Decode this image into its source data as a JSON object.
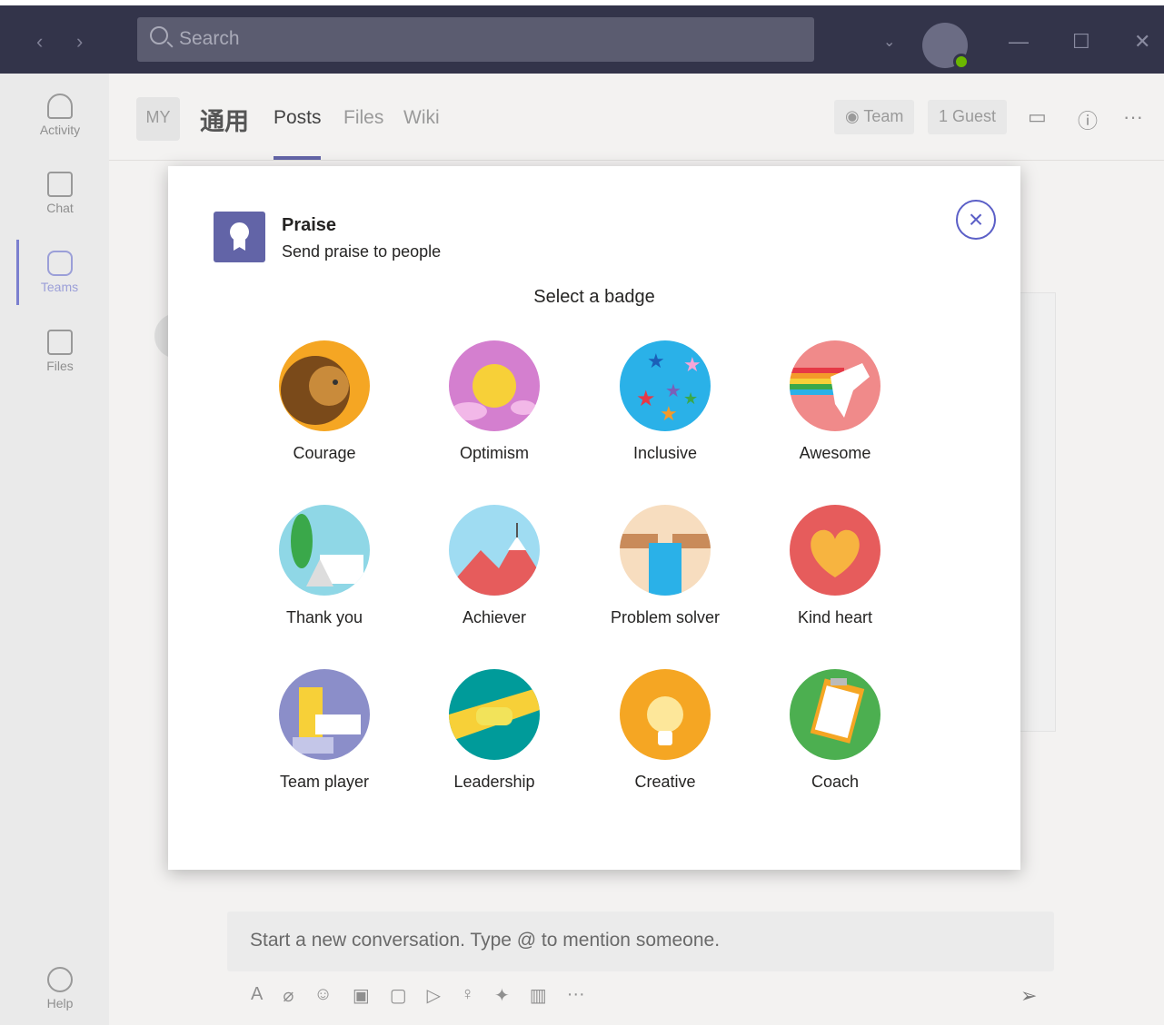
{
  "titlebar": {
    "search_placeholder": "Search",
    "back_icon": "chevron-left-icon",
    "forward_icon": "chevron-right-icon",
    "minimize_icon": "minimize-icon",
    "maximize_icon": "maximize-icon",
    "close_icon": "close-icon"
  },
  "rail": {
    "items": [
      {
        "label": "Activity",
        "icon": "bell-icon"
      },
      {
        "label": "Chat",
        "icon": "chat-icon"
      },
      {
        "label": "Teams",
        "icon": "teams-icon",
        "active": true
      },
      {
        "label": "Files",
        "icon": "file-icon"
      }
    ],
    "help_label": "Help"
  },
  "header": {
    "team_initials": "MY",
    "channel_name": "通用",
    "tabs": [
      "Posts",
      "Files",
      "Wiki"
    ],
    "active_tab": "Posts",
    "team_pill": "Team",
    "guest_pill": "1 Guest"
  },
  "compose": {
    "placeholder": "Start a new conversation. Type @ to mention someone."
  },
  "modal": {
    "title": "Praise",
    "subtitle": "Send praise to people",
    "select_label": "Select a badge",
    "badges": [
      {
        "label": "Courage",
        "color": "#f5a623"
      },
      {
        "label": "Optimism",
        "color": "#d47fcf"
      },
      {
        "label": "Inclusive",
        "color": "#2ab1e8"
      },
      {
        "label": "Awesome",
        "color": "#f08a8a"
      },
      {
        "label": "Thank you",
        "color": "#8fd7e6"
      },
      {
        "label": "Achiever",
        "color": "#9fdcf2"
      },
      {
        "label": "Problem solver",
        "color": "#f7ddbf"
      },
      {
        "label": "Kind heart",
        "color": "#e65c5c"
      },
      {
        "label": "Team player",
        "color": "#8b8ec9"
      },
      {
        "label": "Leadership",
        "color": "#009b9a"
      },
      {
        "label": "Creative",
        "color": "#f5a623"
      },
      {
        "label": "Coach",
        "color": "#4caf50"
      }
    ]
  },
  "colors": {
    "brand": "#6264a7",
    "titlebar": "#33344a"
  }
}
